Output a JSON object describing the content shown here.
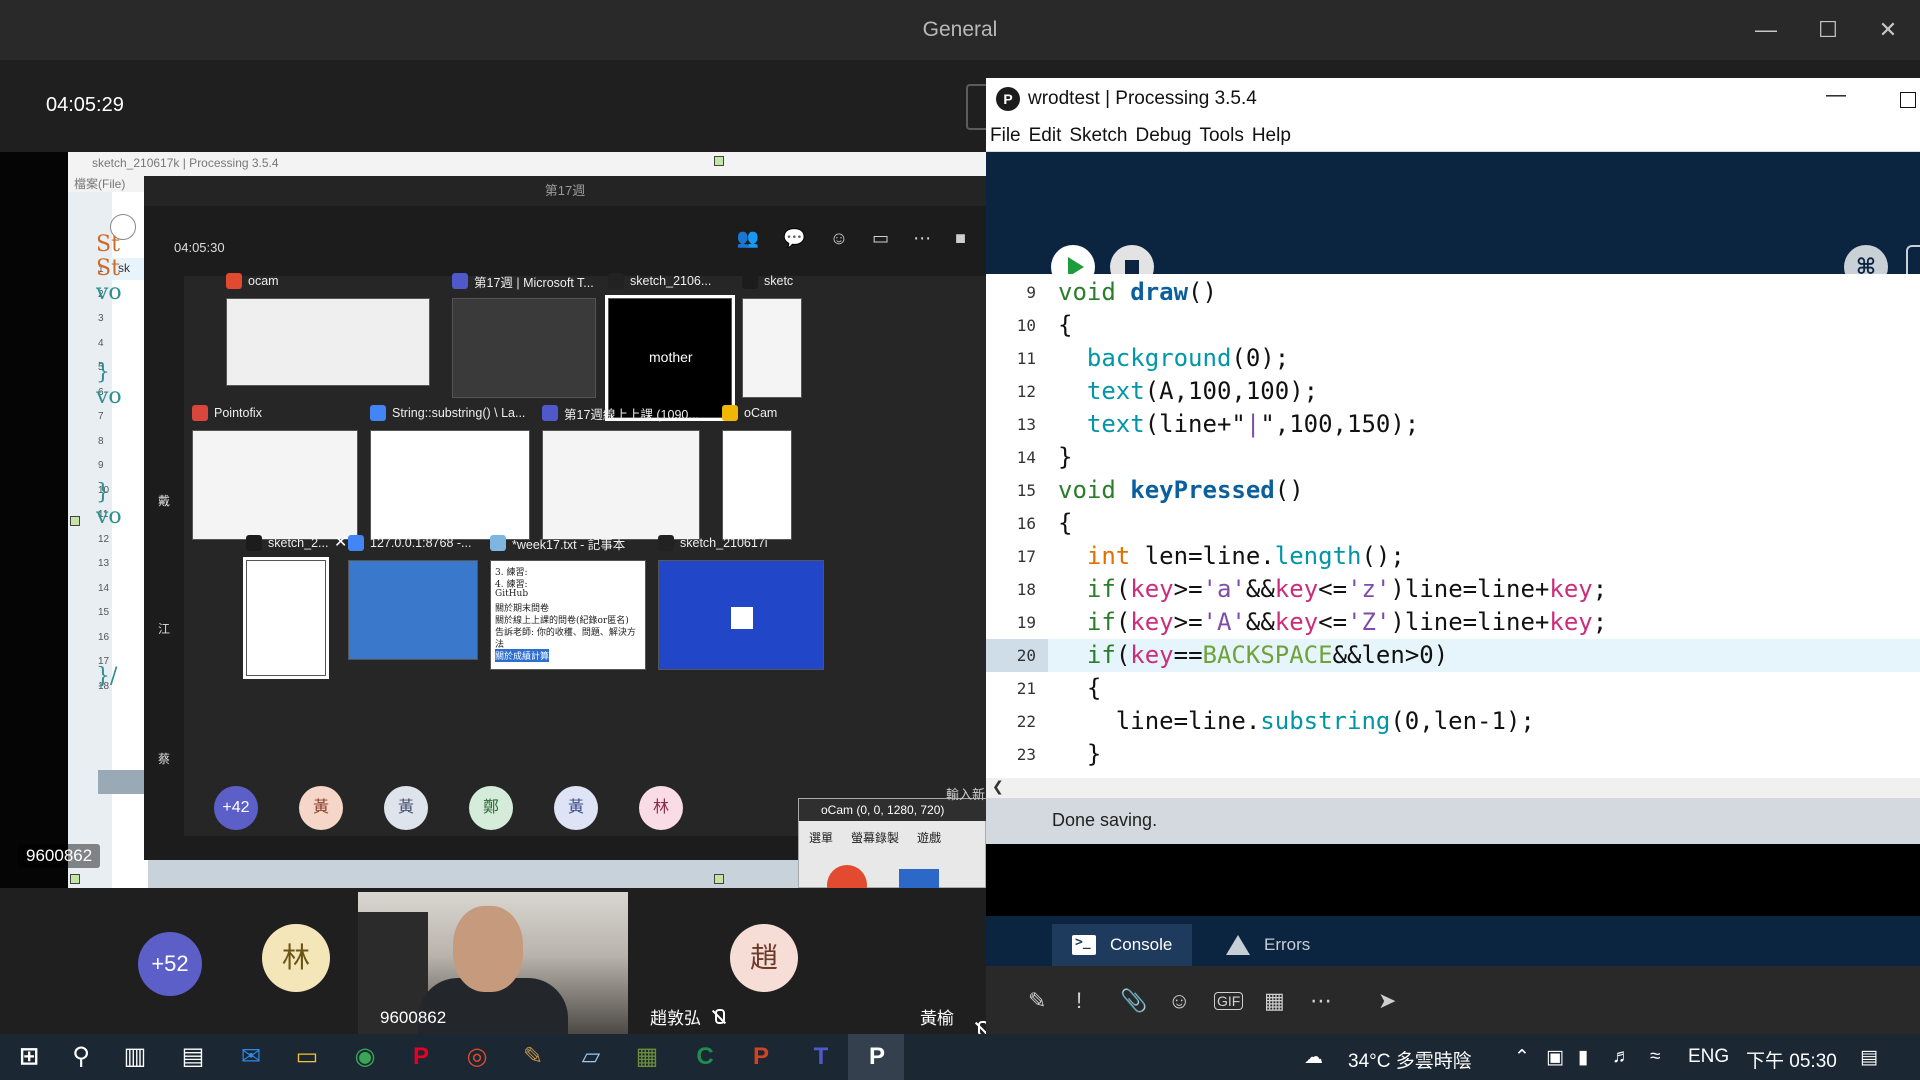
{
  "teams": {
    "title": "General",
    "meeting_time": "04:05:29",
    "shared_screen": {
      "presenter_label": "9600862",
      "processing_behind": {
        "title": "sketch_210617k | Processing 3.5.4",
        "menu": "檔案(File)",
        "tab_fragment": "sk",
        "code_fragments": [
          "St",
          "St",
          "vo",
          "}",
          "vo",
          "}",
          "vo",
          "}/"
        ],
        "line_numbers": [
          "1",
          "2",
          "3",
          "4",
          "5",
          "6",
          "7",
          "8",
          "9",
          "10",
          "11",
          "12",
          "13",
          "14",
          "15",
          "16",
          "17",
          "18"
        ]
      },
      "inner_teams": {
        "title": "第17週",
        "time": "04:05:30",
        "side_labels": [
          "戴",
          "江",
          "蔡"
        ],
        "alt_tab": [
          {
            "name": "ocam",
            "icon_color": "#e04a2e"
          },
          {
            "name": "第17週 | Microsoft T...",
            "icon_color": "#5059c9"
          },
          {
            "name": "sketch_2106...",
            "icon_color": "#222222",
            "content": "mother"
          },
          {
            "name": "sketc",
            "icon_color": "#1c1c1c"
          },
          {
            "name": "Pointofix",
            "icon_color": "#d9463c"
          },
          {
            "name": "String::substring() \\ La...",
            "icon_color": "#4285f4"
          },
          {
            "name": "第17週線上上課 (1090...",
            "icon_color": "#5059c9"
          },
          {
            "name": "oCam",
            "icon_color": "#f2b705"
          },
          {
            "name": "sketch_2...",
            "icon_color": "#1c1c1c"
          },
          {
            "name": "127.0.0.1:8768 -...",
            "icon_color": "#4285f4"
          },
          {
            "name": "*week17.txt - 記事本",
            "icon_color": "#7fb6e0"
          },
          {
            "name": "sketch_210617i",
            "icon_color": "#222222"
          }
        ],
        "notepad_lines": [
          "3. 練習:",
          "4. 練習:",
          "GitHub",
          "關於期末問卷",
          "關於線上上課的問卷(紀錄or匿名)",
          "告訴老師: 你的收穫、問題、解決方",
          "法",
          "關於成績計算"
        ],
        "avatars": [
          {
            "label": "+42",
            "bg": "#5b5fc7",
            "fg": "#ffffff"
          },
          {
            "label": "黃",
            "bg": "#f6d6c9",
            "fg": "#8a3d2a"
          },
          {
            "label": "黃",
            "bg": "#dfe3ec",
            "fg": "#44506a"
          },
          {
            "label": "鄭",
            "bg": "#d4ecd9",
            "fg": "#2e6a3b"
          },
          {
            "label": "黃",
            "bg": "#dfe3f6",
            "fg": "#3b4b8a"
          },
          {
            "label": "林",
            "bg": "#f9dce6",
            "fg": "#8a2c4d"
          }
        ],
        "ocam_title": "oCam (0, 0, 1280, 720)",
        "ocam_tabs": [
          "選單",
          "螢幕錄製",
          "遊戲"
        ],
        "chat_hint": "輸入新"
      }
    },
    "gallery": [
      {
        "label": "+52",
        "bg": "#5b5fc7",
        "fg": "#ffffff"
      },
      {
        "label": "林",
        "bg": "#f4e6b8",
        "fg": "#6b5514"
      },
      {
        "label": "趙",
        "bg": "#f6ded7",
        "fg": "#6b3a2a"
      }
    ],
    "video_name": "9600862",
    "names": {
      "zhao": "趙敦弘",
      "huang": "黃榆萱"
    },
    "partial_avatar": "林"
  },
  "processing": {
    "title": "wrodtest | Processing 3.5.4",
    "menu": [
      "File",
      "Edit",
      "Sketch",
      "Debug",
      "Tools",
      "Help"
    ],
    "tab": "wrodtest",
    "status": "Done saving.",
    "console_tab": "Console",
    "errors_tab": "Errors",
    "line_numbers": [
      "9",
      "10",
      "11",
      "12",
      "13",
      "14",
      "15",
      "16",
      "17",
      "18",
      "19",
      "20",
      "21",
      "22",
      "23"
    ],
    "highlight_line": "20"
  },
  "taskbar": {
    "weather": "34°C 多雲時陰",
    "lang": "ENG",
    "time": "下午 05:30",
    "apps": [
      {
        "name": "windows-start",
        "color": "#ffffff"
      },
      {
        "name": "search",
        "color": "#ffffff"
      },
      {
        "name": "task-view",
        "color": "#ffffff"
      },
      {
        "name": "store",
        "color": "#ffffff"
      },
      {
        "name": "mail",
        "color": "#2c8ae8"
      },
      {
        "name": "explorer",
        "color": "#f3c233"
      },
      {
        "name": "chrome",
        "color": "#3aa757"
      },
      {
        "name": "pinterest",
        "color": "#e60023"
      },
      {
        "name": "ocam",
        "color": "#e04a2e"
      },
      {
        "name": "pointofix",
        "color": "#c0924a"
      },
      {
        "name": "notepad",
        "color": "#9fc7e8"
      },
      {
        "name": "minecraft",
        "color": "#6b8e3a"
      },
      {
        "name": "camtasia",
        "color": "#1e8d4f"
      },
      {
        "name": "powerpoint",
        "color": "#d04423"
      },
      {
        "name": "teams",
        "color": "#5059c9"
      },
      {
        "name": "processing",
        "color": "#ffffff"
      }
    ]
  }
}
